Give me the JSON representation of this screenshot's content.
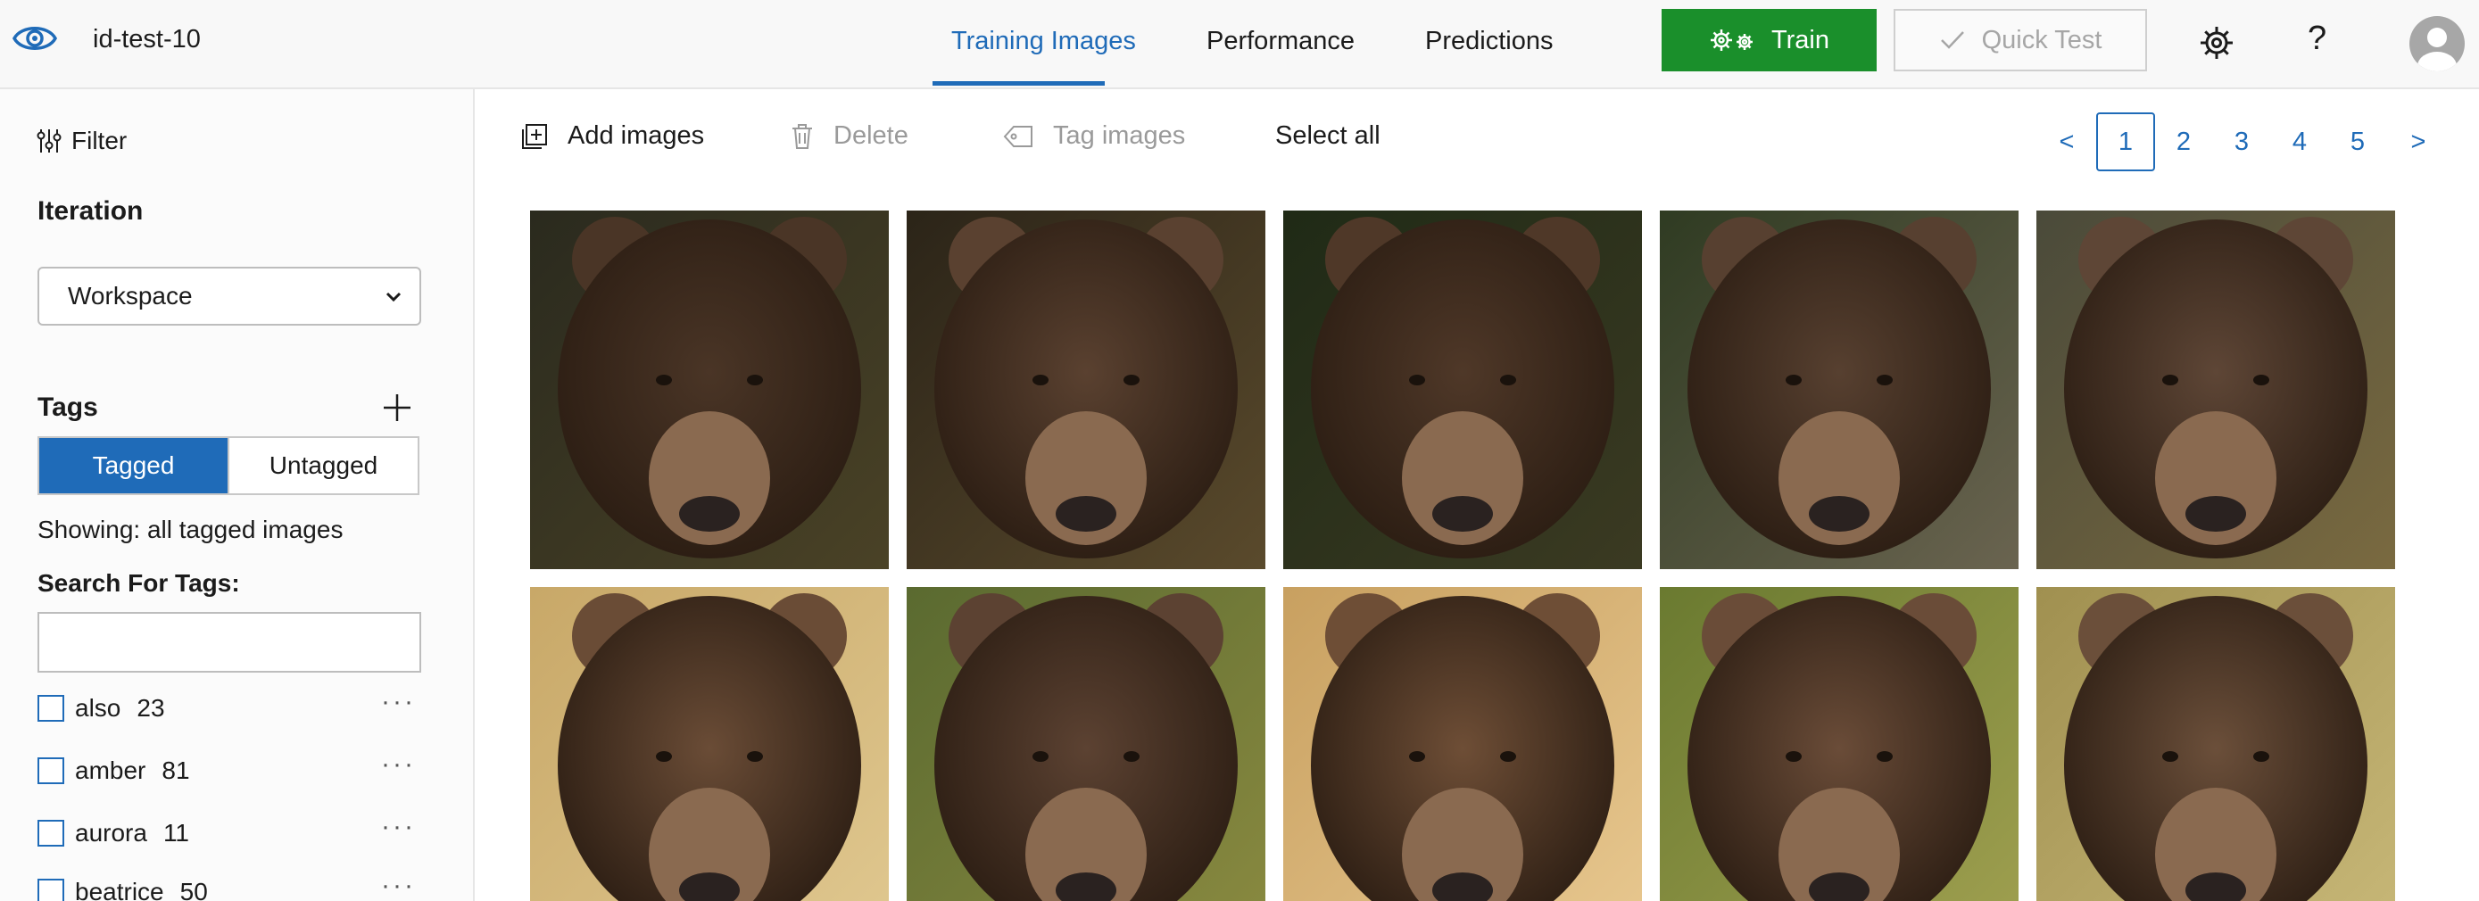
{
  "header": {
    "project_name": "id-test-10",
    "tabs": [
      {
        "label": "Training Images",
        "active": true
      },
      {
        "label": "Performance",
        "active": false
      },
      {
        "label": "Predictions",
        "active": false
      }
    ],
    "train_label": "Train",
    "quick_test_label": "Quick Test",
    "help_label": "?"
  },
  "sidebar": {
    "filter_label": "Filter",
    "iteration_title": "Iteration",
    "iteration_value": "Workspace",
    "tags_title": "Tags",
    "tagged_label": "Tagged",
    "untagged_label": "Untagged",
    "showing_text": "Showing: all tagged images",
    "search_label": "Search For Tags:",
    "search_value": "",
    "tags": [
      {
        "name": "also",
        "count": "23"
      },
      {
        "name": "amber",
        "count": "81"
      },
      {
        "name": "aurora",
        "count": "11"
      },
      {
        "name": "beatrice",
        "count": "50"
      }
    ]
  },
  "toolbar": {
    "add_label": "Add images",
    "delete_label": "Delete",
    "tag_label": "Tag images",
    "select_all_label": "Select all"
  },
  "pagination": {
    "prev": "<",
    "pages": [
      "1",
      "2",
      "3",
      "4",
      "5"
    ],
    "current": "1",
    "next": ">"
  },
  "colors": {
    "accent": "#1f6bb8",
    "train_green": "#1a8f2b"
  },
  "images": [
    {
      "name": "bear-image-1"
    },
    {
      "name": "bear-image-2"
    },
    {
      "name": "bear-image-3"
    },
    {
      "name": "bear-image-4"
    },
    {
      "name": "bear-image-5"
    },
    {
      "name": "bear-image-6"
    },
    {
      "name": "bear-image-7"
    },
    {
      "name": "bear-image-8"
    },
    {
      "name": "bear-image-9"
    },
    {
      "name": "bear-image-10"
    }
  ]
}
